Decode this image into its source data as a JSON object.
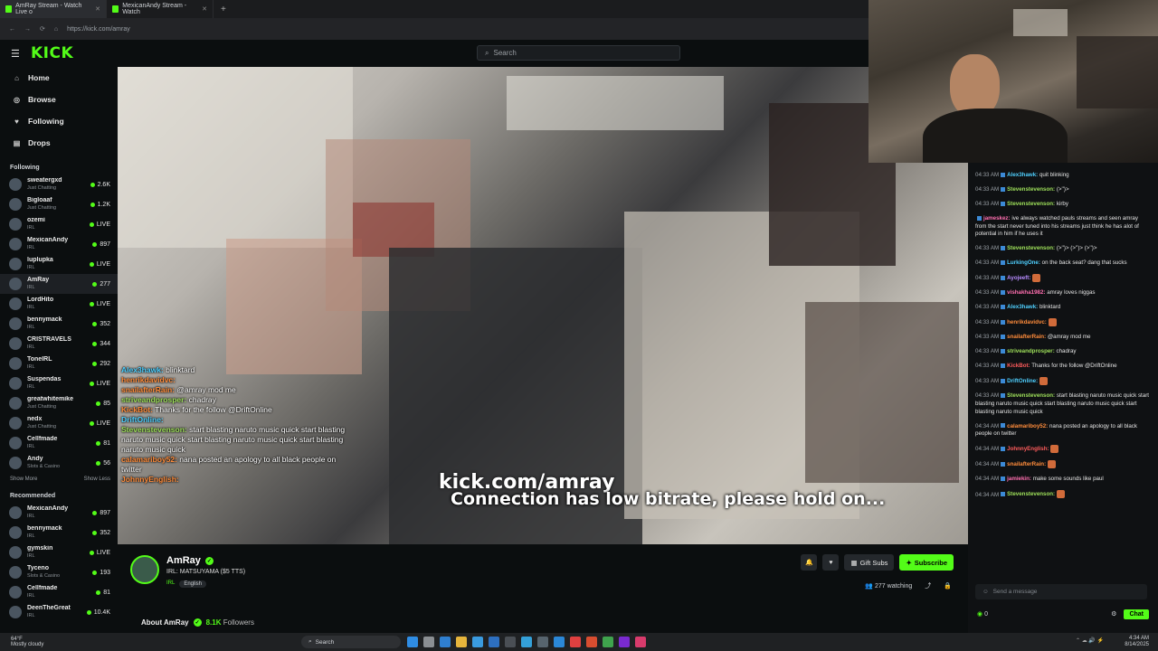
{
  "browser": {
    "tabs": [
      {
        "label": "AmRay Stream - Watch Live o",
        "active": true
      },
      {
        "label": "MexicanAndy Stream - Watch",
        "active": false
      }
    ],
    "url": "https://kick.com/amray"
  },
  "header": {
    "logo": "KICK",
    "search_placeholder": "Search"
  },
  "sidebar": {
    "nav": [
      {
        "label": "Home",
        "icon": "home-icon"
      },
      {
        "label": "Browse",
        "icon": "compass-icon"
      },
      {
        "label": "Following",
        "icon": "heart-icon"
      },
      {
        "label": "Drops",
        "icon": "drop-icon"
      }
    ],
    "following_title": "Following",
    "following": [
      {
        "name": "sweatergxd",
        "category": "Just Chatting",
        "viewers": "2.6K"
      },
      {
        "name": "Bigloaaf",
        "category": "Just Chatting",
        "viewers": "1.2K"
      },
      {
        "name": "ozemi",
        "category": "IRL",
        "viewers": "LIVE"
      },
      {
        "name": "MexicanAndy",
        "category": "IRL",
        "viewers": "897"
      },
      {
        "name": "luplupka",
        "category": "IRL",
        "viewers": "LIVE"
      },
      {
        "name": "AmRay",
        "category": "IRL",
        "viewers": "277"
      },
      {
        "name": "LordHito",
        "category": "IRL",
        "viewers": "LIVE"
      },
      {
        "name": "bennymack",
        "category": "IRL",
        "viewers": "352"
      },
      {
        "name": "CRISTRAVELS",
        "category": "IRL",
        "viewers": "344"
      },
      {
        "name": "ToneIRL",
        "category": "IRL",
        "viewers": "292"
      },
      {
        "name": "Suspendas",
        "category": "IRL",
        "viewers": "LIVE"
      },
      {
        "name": "greatwhitemike",
        "category": "Just Chatting",
        "viewers": "85"
      },
      {
        "name": "nedx",
        "category": "Just Chatting",
        "viewers": "LIVE"
      },
      {
        "name": "Cellfmade",
        "category": "IRL",
        "viewers": "81"
      },
      {
        "name": "Andy",
        "category": "Slots & Casino",
        "viewers": "56"
      }
    ],
    "show_more": "Show More",
    "show_less": "Show Less",
    "recommended_title": "Recommended",
    "recommended": [
      {
        "name": "MexicanAndy",
        "category": "IRL",
        "viewers": "897"
      },
      {
        "name": "bennymack",
        "category": "IRL",
        "viewers": "352"
      },
      {
        "name": "gymskin",
        "category": "IRL",
        "viewers": "LIVE"
      },
      {
        "name": "Tyceno",
        "category": "Slots & Casino",
        "viewers": "193"
      },
      {
        "name": "Cellfmade",
        "category": "IRL",
        "viewers": "81"
      },
      {
        "name": "DeenTheGreat",
        "category": "IRL",
        "viewers": "10.4K"
      }
    ]
  },
  "player": {
    "overlay_chat": [
      {
        "user": "Alex3hawk:",
        "text": "blinktard",
        "cls": "u1"
      },
      {
        "user": "henrikdavidvc:",
        "text": "",
        "cls": "u2"
      },
      {
        "user": "snailafterRain:",
        "text": "@amray mod me",
        "cls": "u2"
      },
      {
        "user": "striveandprosper:",
        "text": "chadray",
        "cls": "u3"
      },
      {
        "user": "KickBot:",
        "text": "Thanks for the follow @DriftOnline",
        "cls": "u2"
      },
      {
        "user": "DriftOnline:",
        "text": "",
        "cls": "u1"
      },
      {
        "user": "Stevenstevenson:",
        "text": "start blasting naruto music quick start blasting naruto music quick start blasting naruto music quick start blasting naruto music quick",
        "cls": "u3"
      },
      {
        "user": "calamariboy52:",
        "text": "nana posted an apology to all black people on twitter",
        "cls": "u2"
      },
      {
        "user": "JohnnyEnglish:",
        "text": "",
        "cls": "u2"
      }
    ],
    "watermark": "kick.com/amray",
    "status_message": "Connection has low bitrate, please hold on..."
  },
  "stream": {
    "name": "AmRay",
    "title": "IRL: MATSUYAMA ($5 TTS)",
    "category": "IRL",
    "language": "English",
    "gift_label": "Gift Subs",
    "subscribe_label": "Subscribe",
    "watching": "277 watching",
    "about_label": "About AmRay",
    "followers_count": "8.1K",
    "followers_label": "Followers"
  },
  "chat": {
    "messages": [
      {
        "time": "04:33 AM",
        "user": "Alex3hawk:",
        "color": "#4fd0ff",
        "text": "quit blinking"
      },
      {
        "time": "04:33 AM",
        "user": "Stevenstevenson:",
        "color": "#9ee05a",
        "text": "(>'')>"
      },
      {
        "time": "04:33 AM",
        "user": "Stevenstevenson:",
        "color": "#9ee05a",
        "text": "kirby"
      },
      {
        "time": "",
        "user": "jameskez:",
        "color": "#ff6fb0",
        "text": "ive always watched pauls streams and seen amray from the start never tuned into his streams just think he has alot of potential in him if he uses it"
      },
      {
        "time": "04:33 AM",
        "user": "Stevenstevenson:",
        "color": "#9ee05a",
        "text": "(>'')> (>'')> (>'')>"
      },
      {
        "time": "04:33 AM",
        "user": "LurkingOne:",
        "color": "#4fd0ff",
        "text": "on the back seat? dang that sucks"
      },
      {
        "time": "04:33 AM",
        "user": "Ayojeeft:",
        "color": "#b88cff",
        "text": ""
      },
      {
        "time": "04:33 AM",
        "user": "vishakha1982:",
        "color": "#ff6fb0",
        "text": "amray loves niggas"
      },
      {
        "time": "04:33 AM",
        "user": "Alex3hawk:",
        "color": "#4fd0ff",
        "text": "blinktard"
      },
      {
        "time": "04:33 AM",
        "user": "henrikdavidvc:",
        "color": "#ff8c3b",
        "text": ""
      },
      {
        "time": "04:33 AM",
        "user": "snailafterRain:",
        "color": "#ff8c3b",
        "text": "@amray mod me"
      },
      {
        "time": "04:33 AM",
        "user": "striveandprosper:",
        "color": "#9ee05a",
        "text": "chadray"
      },
      {
        "time": "04:33 AM",
        "user": "KickBot:",
        "color": "#ff5c5c",
        "text": "Thanks for the follow @DriftOnline"
      },
      {
        "time": "04:33 AM",
        "user": "DriftOnline:",
        "color": "#4fd0ff",
        "text": ""
      },
      {
        "time": "04:33 AM",
        "user": "Stevenstevenson:",
        "color": "#9ee05a",
        "text": "start blasting naruto music quick start blasting naruto music quick start blasting naruto music quick start blasting naruto music quick"
      },
      {
        "time": "04:34 AM",
        "user": "calamariboy52:",
        "color": "#ff8c3b",
        "text": "nana posted an apology to all black people on twitter"
      },
      {
        "time": "04:34 AM",
        "user": "JohnnyEnglish:",
        "color": "#ff5c5c",
        "text": ""
      },
      {
        "time": "04:34 AM",
        "user": "snailafterRain:",
        "color": "#ff8c3b",
        "text": ""
      },
      {
        "time": "04:34 AM",
        "user": "jamiekin:",
        "color": "#ff6fb0",
        "text": "make some sounds like paul"
      },
      {
        "time": "04:34 AM",
        "user": "Stevenstevenson:",
        "color": "#9ee05a",
        "text": ""
      }
    ],
    "input_placeholder": "Send a message",
    "points": "0",
    "chat_button": "Chat"
  },
  "taskbar": {
    "weather_temp": "64°F",
    "weather_desc": "Mostly cloudy",
    "search": "Search",
    "time": "4:34 AM",
    "date": "8/14/2025"
  },
  "colors": {
    "accent": "#53fc18"
  }
}
